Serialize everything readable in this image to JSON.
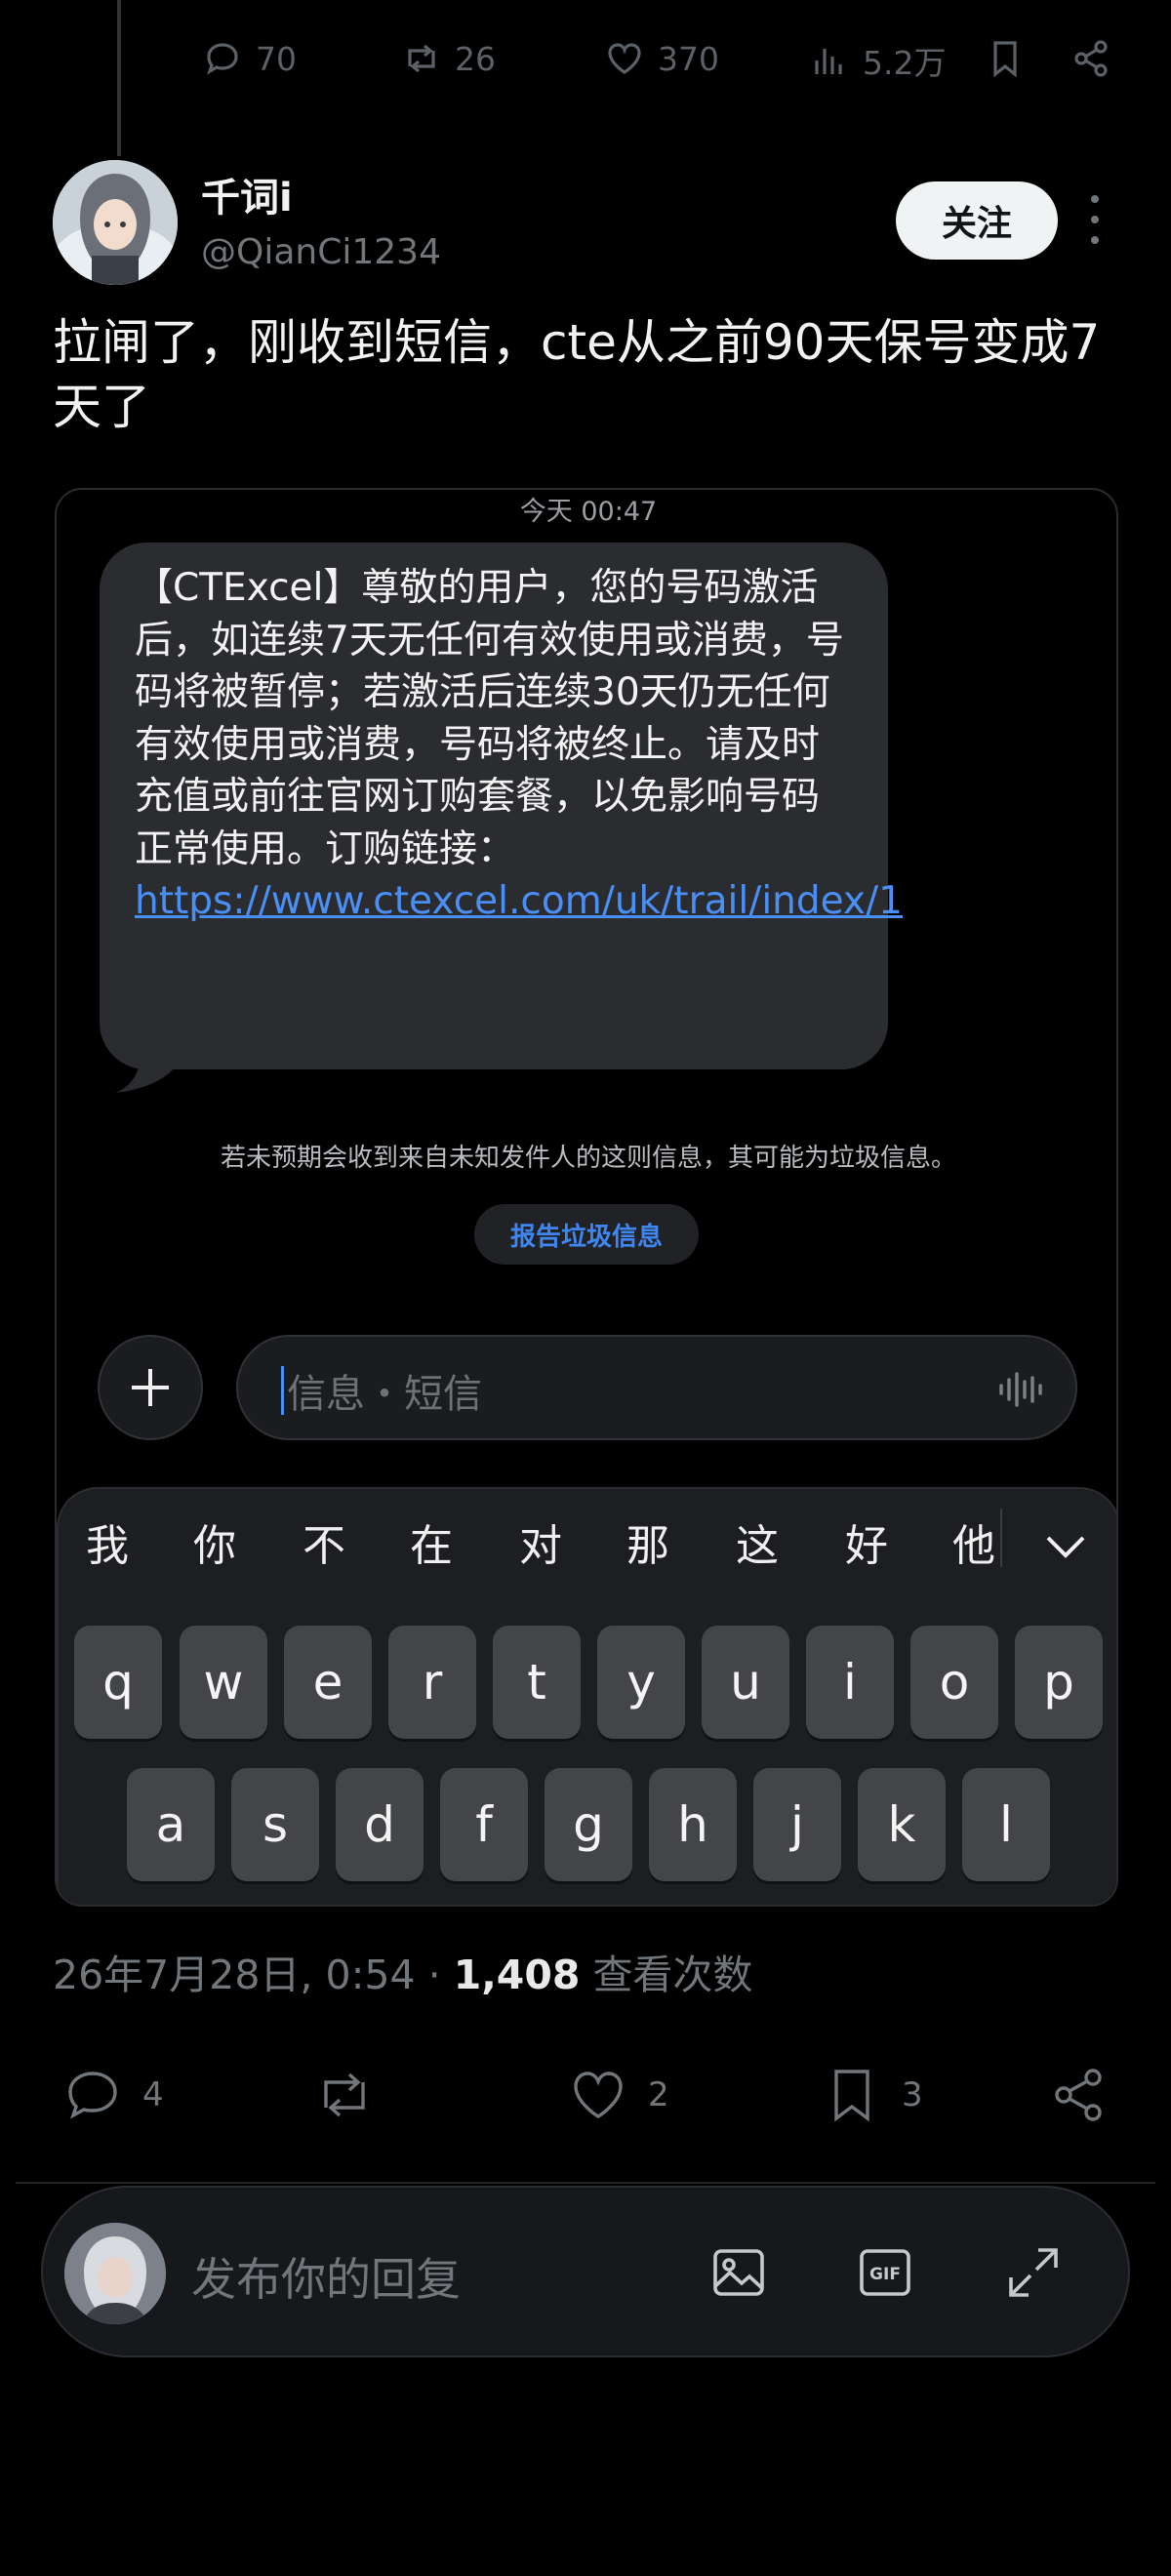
{
  "top_actions": {
    "replies": "70",
    "reposts": "26",
    "likes": "370",
    "views": "5.2万"
  },
  "author": {
    "name": "千词i",
    "handle": "@QianCi1234",
    "follow_label": "关注"
  },
  "post_text": "拉闸了，刚收到短信，cte从之前90天保号变成7天了",
  "embedded_sms": {
    "timestamp": "今天 00:47",
    "message": "【CTExcel】尊敬的用户，您的号码激活后，如连续7天无任何有效使用或消费，号码将被暂停；若激活后连续30天仍无任何有效使用或消费，号码将被终止。请及时充值或前往官网订购套餐，以免影响号码正常使用。订购链接：",
    "link": "https://www.ctexcel.com/uk/trail/index/1",
    "spam_notice": "若未预期会收到来自未知发件人的这则信息，其可能为垃圾信息。",
    "report_label": "报告垃圾信息",
    "input_placeholder": "信息・短信",
    "candidates": [
      "我",
      "你",
      "不",
      "在",
      "对",
      "那",
      "这",
      "好",
      "他"
    ],
    "keys_row1": [
      "q",
      "w",
      "e",
      "r",
      "t",
      "y",
      "u",
      "i",
      "o",
      "p"
    ],
    "keys_row2": [
      "a",
      "s",
      "d",
      "f",
      "g",
      "h",
      "j",
      "k",
      "l"
    ]
  },
  "meta": {
    "date": "26年7月28日, 0:54",
    "separator": "·",
    "views_count": "1,408",
    "views_label": "查看次数"
  },
  "actions": {
    "replies": "4",
    "likes": "2",
    "bookmarks": "3"
  },
  "reply": {
    "placeholder": "发布你的回复"
  },
  "icons": [
    "reply-icon",
    "repost-icon",
    "like-icon",
    "views-icon",
    "bookmark-icon",
    "share-icon",
    "more-icon",
    "plus-icon",
    "waveform-icon",
    "chevron-down-icon",
    "image-icon",
    "gif-icon",
    "expand-icon"
  ]
}
